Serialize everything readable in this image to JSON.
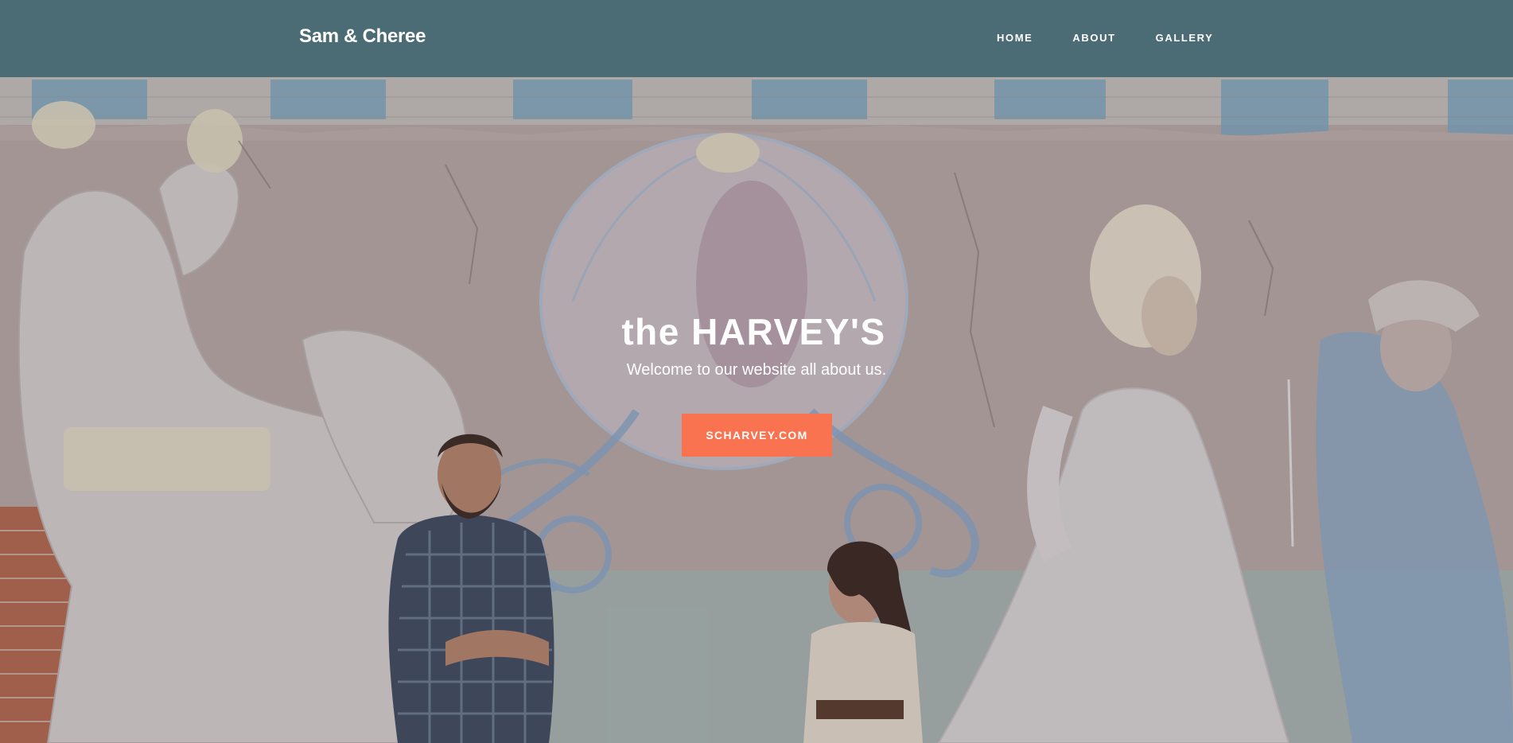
{
  "navbar": {
    "brand": "Sam & Cheree",
    "links": [
      {
        "label": "HOME"
      },
      {
        "label": "ABOUT"
      },
      {
        "label": "GALLERY"
      }
    ],
    "background_color": "#4b6b75"
  },
  "hero": {
    "title": "the HARVEY'S",
    "subtitle": "Welcome to our website all about us.",
    "button_label": "SCHARVEY.COM",
    "button_color": "#fa7350"
  }
}
